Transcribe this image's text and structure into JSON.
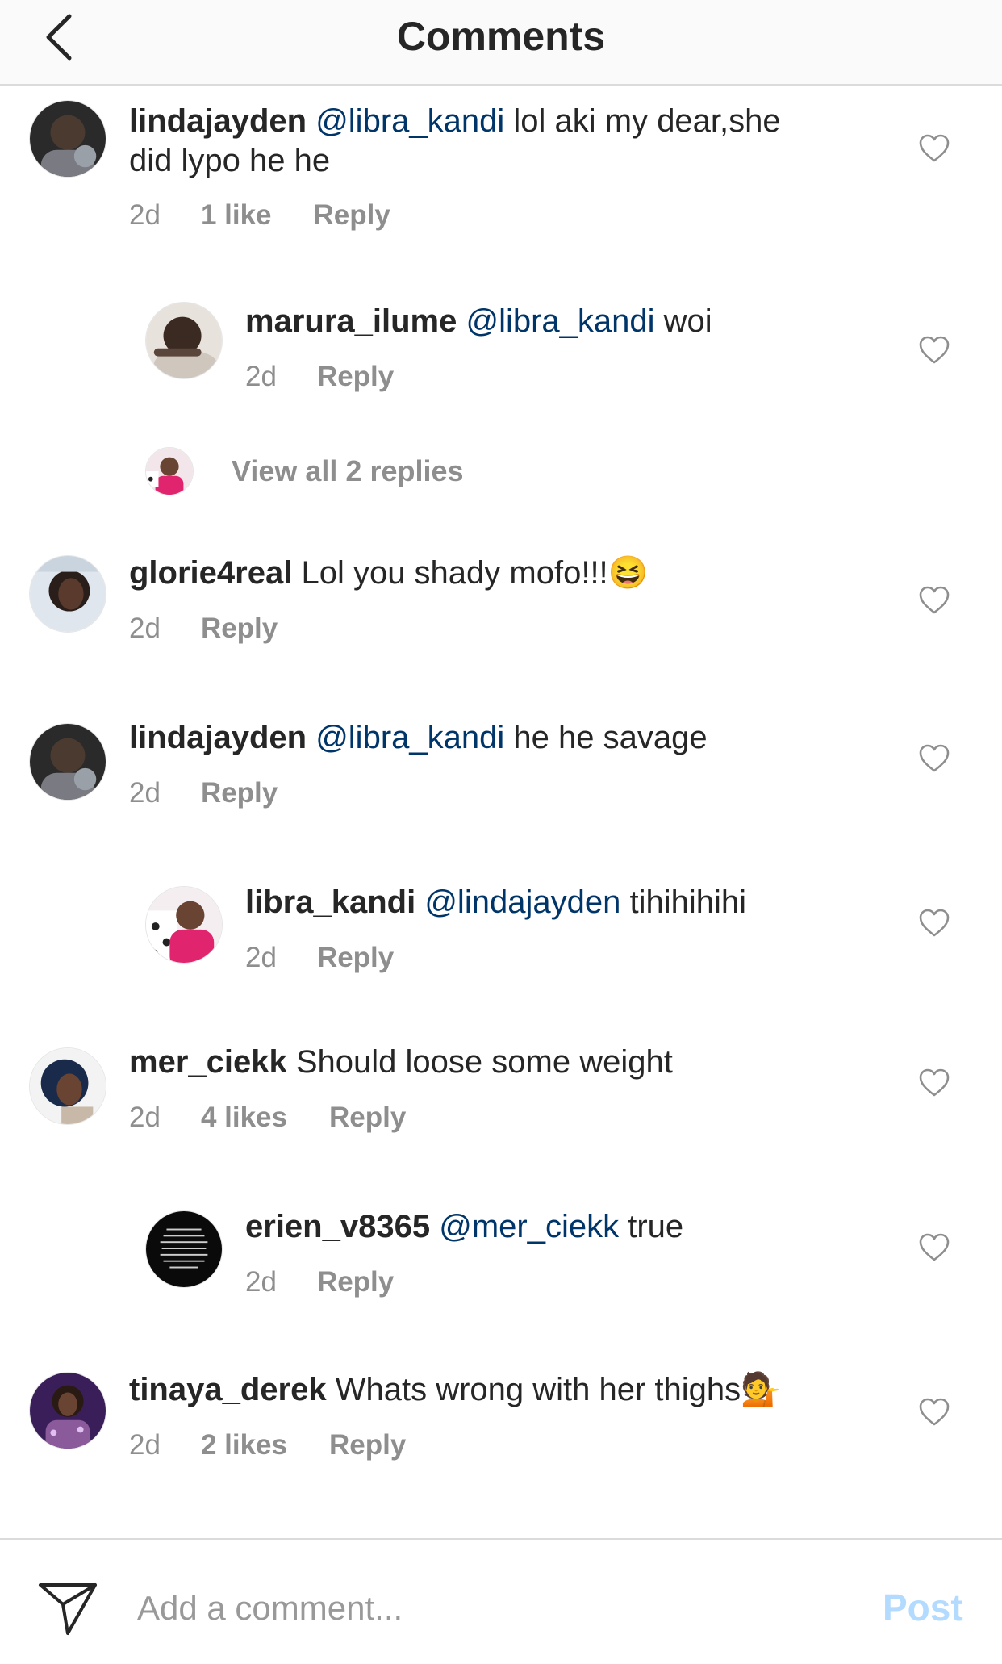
{
  "header": {
    "title": "Comments"
  },
  "comments": [
    {
      "username": "lindajayden",
      "mention": "@libra_kandi",
      "text_line1": "lol aki my dear,she",
      "text_line2": "did lypo he he",
      "time": "2d",
      "likes": "1 like",
      "reply": "Reply"
    },
    {
      "username": "marura_ilume",
      "mention": "@libra_kandi",
      "text": "woi",
      "time": "2d",
      "reply": "Reply"
    },
    {
      "view_replies": "View all 2 replies"
    },
    {
      "username": "glorie4real",
      "text": "Lol you shady mofo!!!",
      "emoji": "😆",
      "time": "2d",
      "reply": "Reply"
    },
    {
      "username": "lindajayden",
      "mention": "@libra_kandi",
      "text": "he he savage",
      "time": "2d",
      "reply": "Reply"
    },
    {
      "username": "libra_kandi",
      "mention": "@lindajayden",
      "text": "tihihihihi",
      "time": "2d",
      "reply": "Reply"
    },
    {
      "username": "mer_ciekk",
      "text": "Should loose some weight",
      "time": "2d",
      "likes": "4 likes",
      "reply": "Reply"
    },
    {
      "username": "erien_v8365",
      "mention": "@mer_ciekk",
      "text": "true",
      "time": "2d",
      "reply": "Reply"
    },
    {
      "username": "tinaya_derek",
      "text": "Whats wrong with her thighs",
      "emoji": "💁",
      "time": "2d",
      "likes": "2 likes",
      "reply": "Reply"
    }
  ],
  "composer": {
    "placeholder": "Add a comment...",
    "post_label": "Post"
  },
  "colors": {
    "mention": "#003569",
    "meta": "#8e8e8e",
    "post_disabled": "#b3dbff"
  }
}
